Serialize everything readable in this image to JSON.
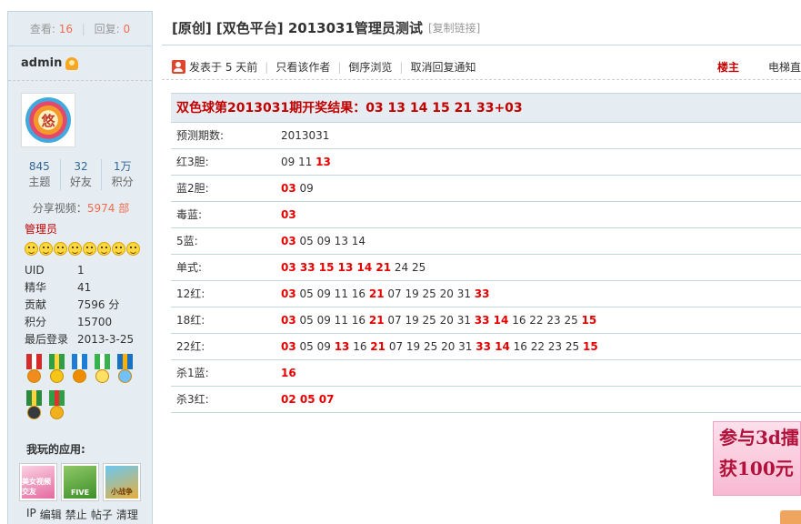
{
  "sidebar": {
    "stats": {
      "views_label": "查看:",
      "views": "16",
      "replies_label": "回复:",
      "replies": "0"
    },
    "author": "admin",
    "avatar_text": "悠",
    "counts": [
      {
        "num": "845",
        "label": "主题"
      },
      {
        "num": "32",
        "label": "好友"
      },
      {
        "num": "1万",
        "label": "积分"
      }
    ],
    "share": {
      "label": "分享视频：",
      "count": "5974",
      "unit": "部"
    },
    "group": "管理员",
    "info": [
      {
        "key": "UID",
        "val": "1"
      },
      {
        "key": "精华",
        "val": "41"
      },
      {
        "key": "贡献",
        "val": "7596 分"
      },
      {
        "key": "积分",
        "val": "15700"
      },
      {
        "key": "最后登录",
        "val": "2013-3-25"
      }
    ],
    "apps_title": "我玩的应用:",
    "apps": [
      "美女视频交友",
      "FIVE",
      "小战争"
    ],
    "admin_links": [
      "IP",
      "编辑",
      "禁止",
      "帖子",
      "清理"
    ]
  },
  "post": {
    "title": "[原创] [双色平台] 2013031管理员测试",
    "copy_link": "[复制链接]",
    "meta": {
      "posted": "发表于 5 天前",
      "only_author": "只看该作者",
      "reverse": "倒序浏览",
      "cancel_notify": "取消回复通知",
      "floor": "楼主",
      "elevator": "电梯直"
    },
    "result_title": "双色球第2013031期开奖结果：03 13 14 15 21 33+03",
    "rows": [
      {
        "label": "预测期数:",
        "parts": [
          {
            "t": "2013031",
            "hot": false
          }
        ]
      },
      {
        "label": "红3胆:",
        "parts": [
          {
            "t": "09 11 ",
            "hot": false
          },
          {
            "t": "13",
            "hot": true
          }
        ]
      },
      {
        "label": "蓝2胆:",
        "parts": [
          {
            "t": "03",
            "hot": true
          },
          {
            "t": " 09",
            "hot": false
          }
        ]
      },
      {
        "label": "毒蓝:",
        "parts": [
          {
            "t": "03",
            "hot": true
          }
        ]
      },
      {
        "label": "5蓝:",
        "parts": [
          {
            "t": "03",
            "hot": true
          },
          {
            "t": " 05 09 13 14",
            "hot": false
          }
        ]
      },
      {
        "label": "单式:",
        "parts": [
          {
            "t": "03 33 15 13 14 21",
            "hot": true
          },
          {
            "t": " 24 25",
            "hot": false
          }
        ]
      },
      {
        "label": "12红:",
        "parts": [
          {
            "t": "03",
            "hot": true
          },
          {
            "t": " 05 09 11 16 ",
            "hot": false
          },
          {
            "t": "21",
            "hot": true
          },
          {
            "t": " 07 19 25 20 31 ",
            "hot": false
          },
          {
            "t": "33",
            "hot": true
          }
        ]
      },
      {
        "label": "18红:",
        "parts": [
          {
            "t": "03",
            "hot": true
          },
          {
            "t": " 05 09 11 16 ",
            "hot": false
          },
          {
            "t": "21",
            "hot": true
          },
          {
            "t": " 07 19 25 20 31 ",
            "hot": false
          },
          {
            "t": "33 14",
            "hot": true
          },
          {
            "t": " 16 22 23 25 ",
            "hot": false
          },
          {
            "t": "15",
            "hot": true
          }
        ]
      },
      {
        "label": "22红:",
        "parts": [
          {
            "t": "03",
            "hot": true
          },
          {
            "t": " 05 09 ",
            "hot": false
          },
          {
            "t": "13",
            "hot": true
          },
          {
            "t": " 16 ",
            "hot": false
          },
          {
            "t": "21",
            "hot": true
          },
          {
            "t": " 07 19 25 20 31 ",
            "hot": false
          },
          {
            "t": "33 14",
            "hot": true
          },
          {
            "t": " 16 22 23 25 ",
            "hot": false
          },
          {
            "t": "15",
            "hot": true
          }
        ]
      },
      {
        "label": "杀1蓝:",
        "parts": [
          {
            "t": "16",
            "hot": true
          }
        ]
      },
      {
        "label": "杀3红:",
        "parts": [
          {
            "t": "02 05 07",
            "hot": true
          }
        ]
      }
    ],
    "banner": {
      "line1": "参与3d擂",
      "line2": "获100元"
    }
  },
  "colors": {
    "accent_red": "#e60000",
    "border_blue": "#c2d5e3",
    "sidebar_bg": "#e5edf2"
  }
}
